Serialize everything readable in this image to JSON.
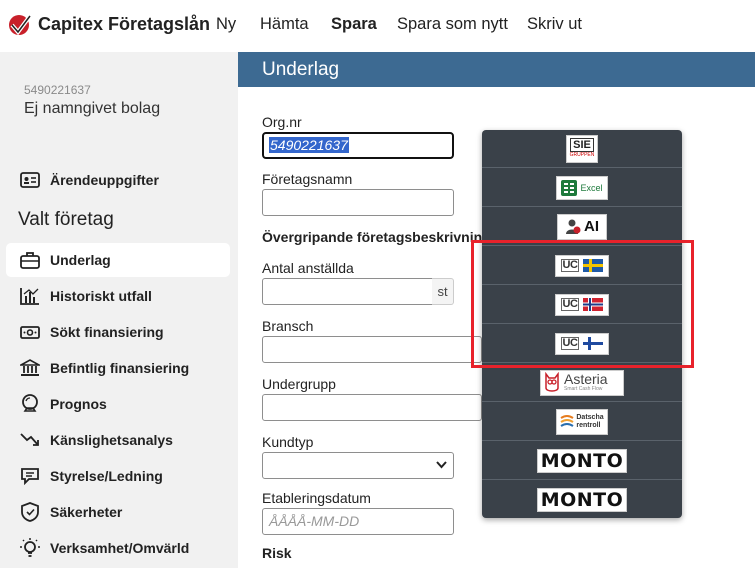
{
  "header": {
    "app_title": "Capitex Företagslån",
    "nav": [
      "Ny",
      "Hämta",
      "Spara",
      "Spara som nytt",
      "Skriv ut"
    ],
    "active_nav": "Spara"
  },
  "sidebar": {
    "company_id": "5490221637",
    "company_name": "Ej namngivet bolag",
    "top_item": "Ärendeuppgifter",
    "section_heading": "Valt företag",
    "items": [
      {
        "label": "Underlag",
        "icon": "briefcase-icon",
        "active": true
      },
      {
        "label": "Historiskt utfall",
        "icon": "bar-chart-icon"
      },
      {
        "label": "Sökt finansiering",
        "icon": "money-icon"
      },
      {
        "label": "Befintlig finansiering",
        "icon": "bank-icon"
      },
      {
        "label": "Prognos",
        "icon": "crystal-ball-icon"
      },
      {
        "label": "Känslighetsanalys",
        "icon": "trend-arrow-icon"
      },
      {
        "label": "Styrelse/Ledning",
        "icon": "people-icon"
      },
      {
        "label": "Säkerheter",
        "icon": "shield-icon"
      },
      {
        "label": "Verksamhet/Omvärld",
        "icon": "lightbulb-icon"
      }
    ]
  },
  "main": {
    "section_title": "Underlag",
    "org_nr_label": "Org.nr",
    "org_nr_value": "5490221637",
    "foretagsnamn_label": "Företagsnamn",
    "foretagsnamn_value": "",
    "overgripande_heading": "Övergripande företagsbeskrivning",
    "antal_label": "Antal anställda",
    "antal_value": "",
    "antal_suffix": "st",
    "bransch_label": "Bransch",
    "undergrupp_label": "Undergrupp",
    "kundtyp_label": "Kundtyp",
    "kundtyp_value": "",
    "etablering_label": "Etableringsdatum",
    "etablering_placeholder": "ÅÅÅÅ-MM-DD",
    "risk_heading": "Risk"
  },
  "import_menu": {
    "items": [
      {
        "name": "SIE",
        "label": "SIE",
        "sub": "GRUPPEN"
      },
      {
        "name": "Excel",
        "label": "Excel"
      },
      {
        "name": "AI",
        "label": "AI"
      },
      {
        "name": "UC Sverige",
        "label": "UC",
        "flag": "se"
      },
      {
        "name": "UC Norge",
        "label": "UC",
        "flag": "no"
      },
      {
        "name": "UC Finland",
        "label": "UC",
        "flag": "fi"
      },
      {
        "name": "Asteria",
        "label": "Asteria",
        "sub": "Smart Cash Flow"
      },
      {
        "name": "Datscha",
        "label": "Datscha",
        "sub": "rentroll"
      },
      {
        "name": "Monto 1",
        "label": "MONTO"
      },
      {
        "name": "Monto 2",
        "label": "MONTO"
      }
    ],
    "highlight_color": "#e8222b"
  },
  "colors": {
    "header_bar": "#3d6a92",
    "menu_bg": "#3a4149",
    "sidebar_bg": "#f1f1f1",
    "selection": "#3366cc"
  }
}
